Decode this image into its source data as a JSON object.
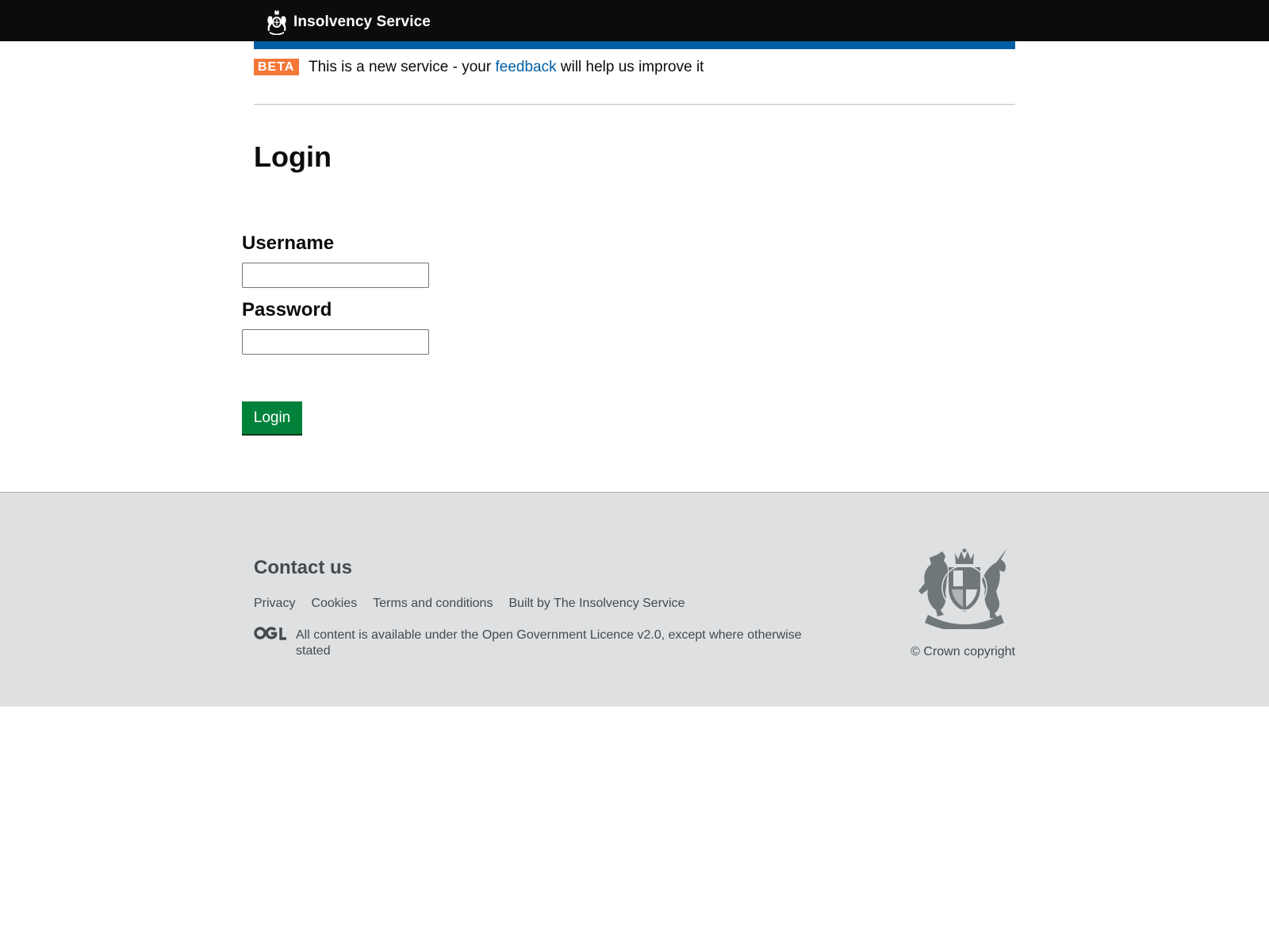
{
  "header": {
    "service_name": "Insolvency Service",
    "crest_icon": "royal-crest-icon",
    "background_color": "#0b0c0c",
    "accent_bar_color": "#005ea5"
  },
  "phase_banner": {
    "tag": "BETA",
    "tag_color": "#f47738",
    "text_before": "This is a new service - your ",
    "link_text": "feedback",
    "text_after": " will help us improve it"
  },
  "main": {
    "title": "Login",
    "username": {
      "label": "Username",
      "value": ""
    },
    "password": {
      "label": "Password",
      "value": ""
    },
    "submit_label": "Login",
    "button_color": "#00823b"
  },
  "footer": {
    "heading": "Contact us",
    "links": [
      {
        "label": "Privacy"
      },
      {
        "label": "Cookies"
      },
      {
        "label": "Terms and conditions"
      },
      {
        "label": "Built by The Insolvency Service"
      }
    ],
    "ogl_icon": "ogl-logo-icon",
    "licence_text": "All content is available under the Open Government Licence v2.0, except where otherwise stated",
    "crest_icon": "royal-coat-of-arms-icon",
    "copyright": "© Crown copyright",
    "background_color": "#dee0e2"
  }
}
